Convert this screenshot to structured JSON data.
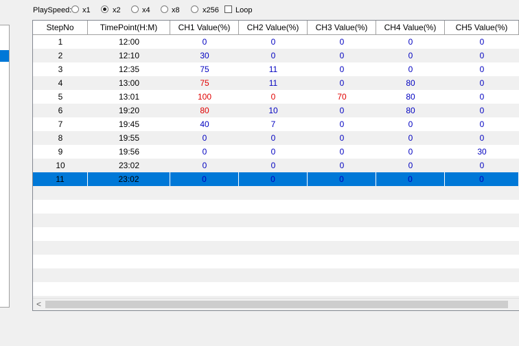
{
  "toolbar": {
    "playspeed_label": "PlaySpeed:",
    "options": [
      {
        "label": "x1",
        "checked": false
      },
      {
        "label": "x2",
        "checked": true
      },
      {
        "label": "x4",
        "checked": false
      },
      {
        "label": "x8",
        "checked": false
      },
      {
        "label": "x256",
        "checked": false
      }
    ],
    "loop_label": "Loop",
    "loop_checked": false
  },
  "grid": {
    "columns": [
      "StepNo",
      "TimePoint(H:M)",
      "CH1 Value(%)",
      "CH2 Value(%)",
      "CH3 Value(%)",
      "CH4 Value(%)",
      "CH5 Value(%)"
    ],
    "rows": [
      [
        "1",
        "12:00",
        "0",
        "0",
        "0",
        "0",
        "0"
      ],
      [
        "2",
        "12:10",
        "30",
        "0",
        "0",
        "0",
        "0"
      ],
      [
        "3",
        "12:35",
        "75",
        "11",
        "0",
        "0",
        "0"
      ],
      [
        "4",
        "13:00",
        "75",
        "11",
        "0",
        "80",
        "0"
      ],
      [
        "5",
        "13:01",
        "100",
        "0",
        "70",
        "80",
        "0"
      ],
      [
        "6",
        "19:20",
        "80",
        "10",
        "0",
        "80",
        "0"
      ],
      [
        "7",
        "19:45",
        "40",
        "7",
        "0",
        "0",
        "0"
      ],
      [
        "8",
        "19:55",
        "0",
        "0",
        "0",
        "0",
        "0"
      ],
      [
        "9",
        "19:56",
        "0",
        "0",
        "0",
        "0",
        "30"
      ],
      [
        "10",
        "23:02",
        "0",
        "0",
        "0",
        "0",
        "0"
      ],
      [
        "11",
        "23:02",
        "0",
        "0",
        "0",
        "0",
        "0"
      ]
    ],
    "red_cells": [
      [
        3,
        2
      ],
      [
        4,
        2
      ],
      [
        4,
        3
      ],
      [
        4,
        4
      ],
      [
        5,
        2
      ]
    ],
    "selected_row": 10,
    "empty_rows": 9
  },
  "colors": {
    "value_blue": "#0000c0",
    "value_red": "#e00000",
    "selection": "#0078d7"
  },
  "scrollbar": {
    "left_arrow": "<"
  }
}
